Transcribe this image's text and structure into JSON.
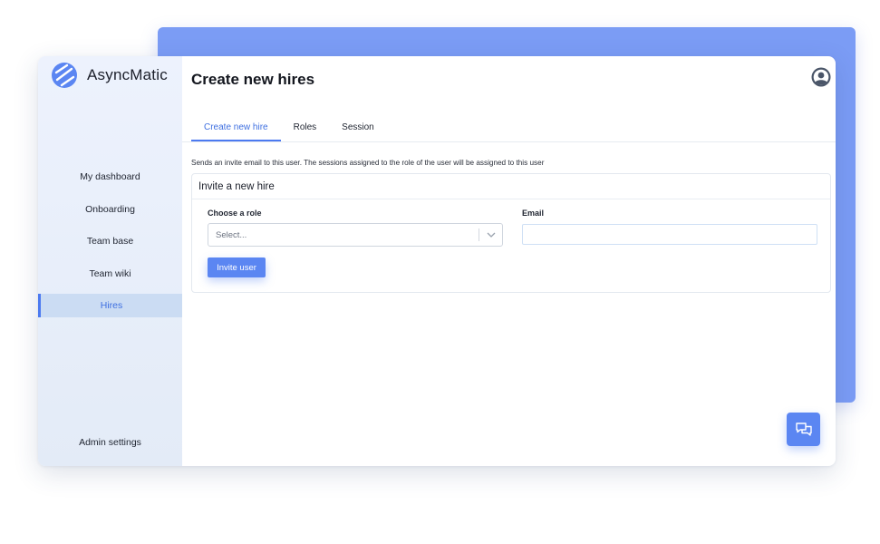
{
  "brand": {
    "name": "AsyncMatic",
    "logo_icon": "asyncmatic-logo-icon"
  },
  "sidebar": {
    "items": [
      {
        "label": "My dashboard",
        "active": false
      },
      {
        "label": "Onboarding",
        "active": false
      },
      {
        "label": "Team base",
        "active": false
      },
      {
        "label": "Team wiki",
        "active": false
      },
      {
        "label": "Hires",
        "active": true
      }
    ],
    "admin_label": "Admin settings"
  },
  "header": {
    "title": "Create new hires",
    "avatar_icon": "user-avatar-icon"
  },
  "tabs": [
    {
      "label": "Create new hire",
      "active": true
    },
    {
      "label": "Roles",
      "active": false
    },
    {
      "label": "Session",
      "active": false
    }
  ],
  "form": {
    "description": "Sends an invite email to this user. The sessions assigned to the role of the user will be assigned to this user",
    "card_title": "Invite a new hire",
    "role_label": "Choose a role",
    "role_placeholder": "Select...",
    "email_label": "Email",
    "email_value": "",
    "submit_label": "Invite user"
  },
  "chat": {
    "icon": "chat-bubbles-icon"
  },
  "colors": {
    "accent": "#4c7af0",
    "backdrop": "#7b9cf5",
    "sidebar_active_bg": "#cbdcf3",
    "button": "#5b86f2"
  }
}
